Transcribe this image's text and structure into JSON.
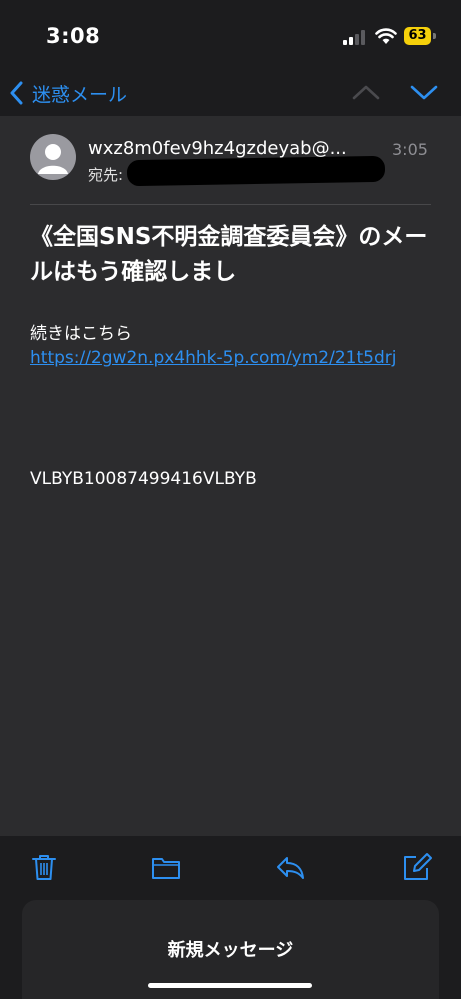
{
  "status_bar": {
    "time": "3:08",
    "battery": "63"
  },
  "nav": {
    "back_label": "迷惑メール"
  },
  "message": {
    "sender": "wxz8m0fev9hz4gzdeyab@...",
    "time": "3:05",
    "to_label": "宛先:",
    "subject": "《全国SNS不明金調査委員会》のメールはもう確認しまし",
    "body_text": "続きはこちら",
    "link_text": "https://2gw2n.px4hhk-5p.com/ym2/21t5drj",
    "code": "VLBYB10087499416VLBYB"
  },
  "sheet": {
    "title": "新規メッセージ"
  },
  "colors": {
    "accent": "#2d8ff0",
    "battery": "#f5d00b",
    "background": "#1c1c1e",
    "card": "#2c2c2e"
  },
  "icons": [
    "signal-icon",
    "wifi-icon",
    "battery-icon",
    "chevron-left-icon",
    "chevron-up-icon",
    "chevron-down-icon",
    "avatar-icon",
    "trash-icon",
    "folder-icon",
    "reply-icon",
    "compose-icon"
  ]
}
